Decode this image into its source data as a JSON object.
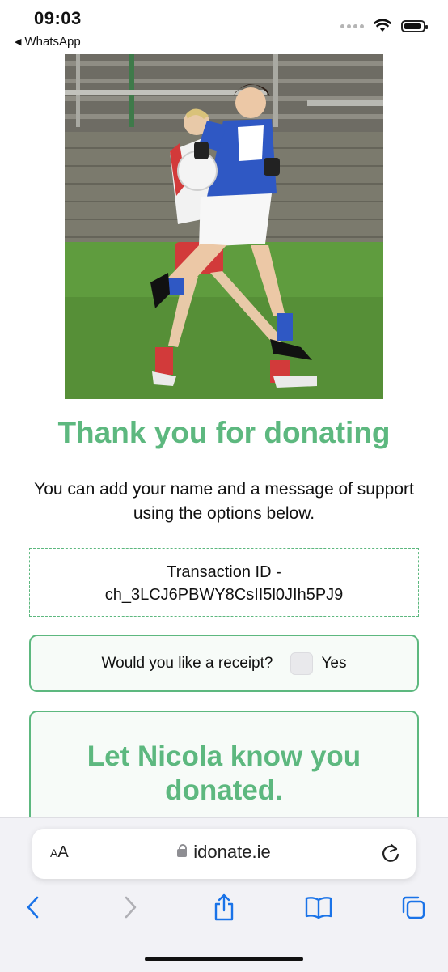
{
  "status_bar": {
    "time": "09:03",
    "back_app": "WhatsApp",
    "back_icon": "back-triangle-icon",
    "icons": [
      "signal-dots-icon",
      "wifi-icon",
      "battery-icon"
    ]
  },
  "hero_image": {
    "subject": "photo-of-ladies-football-players"
  },
  "heading": "Thank you for donating",
  "subtitle": "You can add your name and a message of support using the options below.",
  "transaction": {
    "label": "Transaction ID -",
    "id": "ch_3LCJ6PBWY8CsII5l0JIh5PJ9"
  },
  "receipt": {
    "question": "Would you like a receipt?",
    "option_label": "Yes",
    "checked": false
  },
  "notify_card": {
    "line1": "Let Nicola know you",
    "line2": "donated."
  },
  "browser": {
    "text_size_label_small": "A",
    "text_size_label_large": "A",
    "url": "idonate.ie",
    "toolbar_icons": [
      "back-chevron-icon",
      "forward-chevron-icon",
      "share-icon",
      "bookmarks-icon",
      "tabs-icon"
    ]
  },
  "colors": {
    "accent": "#5db87f",
    "ios_blue": "#1a73e8"
  }
}
